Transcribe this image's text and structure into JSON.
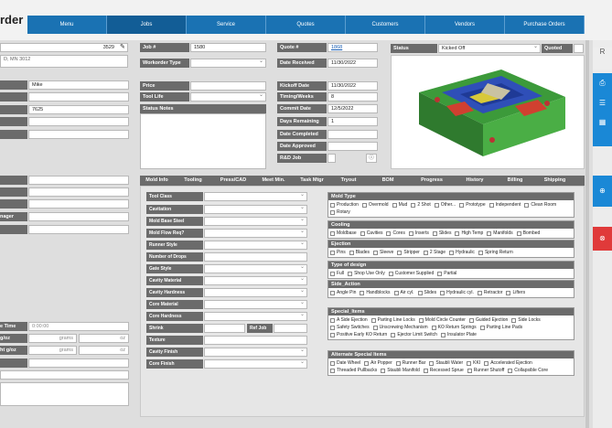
{
  "app": {
    "title": "rder"
  },
  "nav": [
    "Menu",
    "Jobs",
    "Service",
    "Quotes",
    "Customers",
    "Vendors",
    "Purchase Orders"
  ],
  "left": {
    "top_value": "3529",
    "address": "D, MN 3012",
    "name_value": "Mike",
    "zip_value": "7625",
    "job_time_label": "e Time",
    "job_time_value": "0:00:00",
    "grams_label_1": "g/oz",
    "grams_label_2": "ht g/oz",
    "grams_unit": "grams",
    "oz_unit": "oz",
    "manager_label": "nager"
  },
  "job": {
    "job_label": "Job #",
    "job_value": "1580",
    "wo_type_label": "Workorder Type",
    "price_label": "Price",
    "tool_life_label": "Tool Life",
    "status_notes_label": "Status Notes"
  },
  "quote": {
    "quote_label": "Quote #",
    "quote_value": "1868",
    "date_received_label": "Date Received",
    "date_received_value": "11/30/2022",
    "kickoff_label": "Kickoff Date",
    "kickoff_value": "11/30/2022",
    "timing_label": "Timing/Weeks",
    "timing_value": "8",
    "commit_label": "Commit Date",
    "commit_value": "12/5/2022",
    "days_label": "Days Remaining",
    "days_value": "1",
    "completed_label": "Date Completed",
    "approved_label": "Date Approved",
    "rd_label": "R&D Job"
  },
  "status": {
    "label": "Status",
    "value": "Kicked Off",
    "quoted_label": "Quoted"
  },
  "tabs": [
    "Mold Info",
    "Tooling",
    "Press/CAD",
    "Meet Min.",
    "Task Mtgr",
    "Tryout",
    "BOM",
    "Progress",
    "History",
    "Billing",
    "Shipping"
  ],
  "mold_fields": [
    "Tool Class",
    "Cavitation",
    "Mold Base Steel",
    "Mold Flow Req?",
    "Runner Style",
    "Number of Drops",
    "Gate Style",
    "Cavity Material",
    "Cavity Hardness",
    "Core Material",
    "Core Hardness",
    "Shrink",
    "Texture",
    "Cavity Finish",
    "Core Finish"
  ],
  "ref_job_label": "Ref Job",
  "groups": [
    {
      "title": "Mold Type",
      "options": [
        "Production",
        "Overmold",
        "Mud",
        "2 Shot",
        "Other...",
        "Prototype",
        "Independent",
        "Clean Room",
        "Rotary"
      ]
    },
    {
      "title": "Cooling",
      "options": [
        "Moldbase",
        "Cavities",
        "Cores",
        "Inserts",
        "Slides",
        "High Temp",
        "Manifolds",
        "Bombed"
      ]
    },
    {
      "title": "Ejection",
      "options": [
        "Pins",
        "Blades",
        "Sleeve",
        "Stripper",
        "2 Stage",
        "Hydraulic",
        "Spring Return"
      ]
    },
    {
      "title": "Type of design",
      "options": [
        "Full",
        "Shop Use Only",
        "Customer Supplied",
        "Partial"
      ]
    },
    {
      "title": "Side_Action",
      "options": [
        "Angle Pin",
        "Handblocks",
        "Air cyl.",
        "Slides",
        "Hydraulic cyl.",
        "Retractor",
        "Lifters"
      ]
    },
    {
      "title": "Special_Items",
      "options": [
        "A Side Ejection",
        "Parting Line Locks",
        "Mold Circle Counter",
        "Guided Ejection",
        "Side Locks",
        "Safety Switches",
        "Unscrewing Mechanism",
        "KO Return Springs",
        "Parting Line Pads",
        "Positive Early KO Return",
        "Ejector Limit Switch",
        "Insulator Plate"
      ]
    },
    {
      "title": "Alternate Special Items",
      "options": [
        "Date Wheel",
        "Air Popper",
        "Runner Bar",
        "Staubli Water",
        "KKI",
        "Accelerated Ejection",
        "Threaded Pullbacks",
        "Staubli Manifold",
        "Recessed Sprue",
        "Runner Shutoff",
        "Collapsible Core"
      ]
    }
  ],
  "colors": {
    "nav_blue": "#1a72b3",
    "label_gray": "#6b6b6b",
    "side_blue": "#1a88d6",
    "side_red": "#e03a3a"
  }
}
